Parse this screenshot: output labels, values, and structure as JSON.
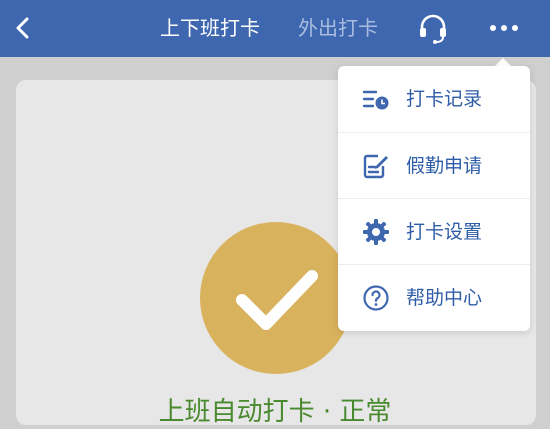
{
  "header": {
    "back_icon": "chevron-left-icon",
    "tabs": [
      {
        "label": "上下班打卡",
        "active": true
      },
      {
        "label": "外出打卡",
        "active": false
      }
    ],
    "support_icon": "headset-icon",
    "more_icon": "more-horizontal-icon"
  },
  "menu": {
    "items": [
      {
        "label": "打卡记录",
        "icon": "clock-list-icon"
      },
      {
        "label": "假勤申请",
        "icon": "edit-form-icon"
      },
      {
        "label": "打卡设置",
        "icon": "gear-icon"
      },
      {
        "label": "帮助中心",
        "icon": "help-circle-icon"
      }
    ]
  },
  "main": {
    "status_icon": "checkmark-icon",
    "status_text": "上班自动打卡 · 正常"
  },
  "colors": {
    "nav_bar": "#3f67b0",
    "menu_text": "#2f5da8",
    "check_circle": "#d9b25e",
    "status_text": "#4a8a2f"
  }
}
